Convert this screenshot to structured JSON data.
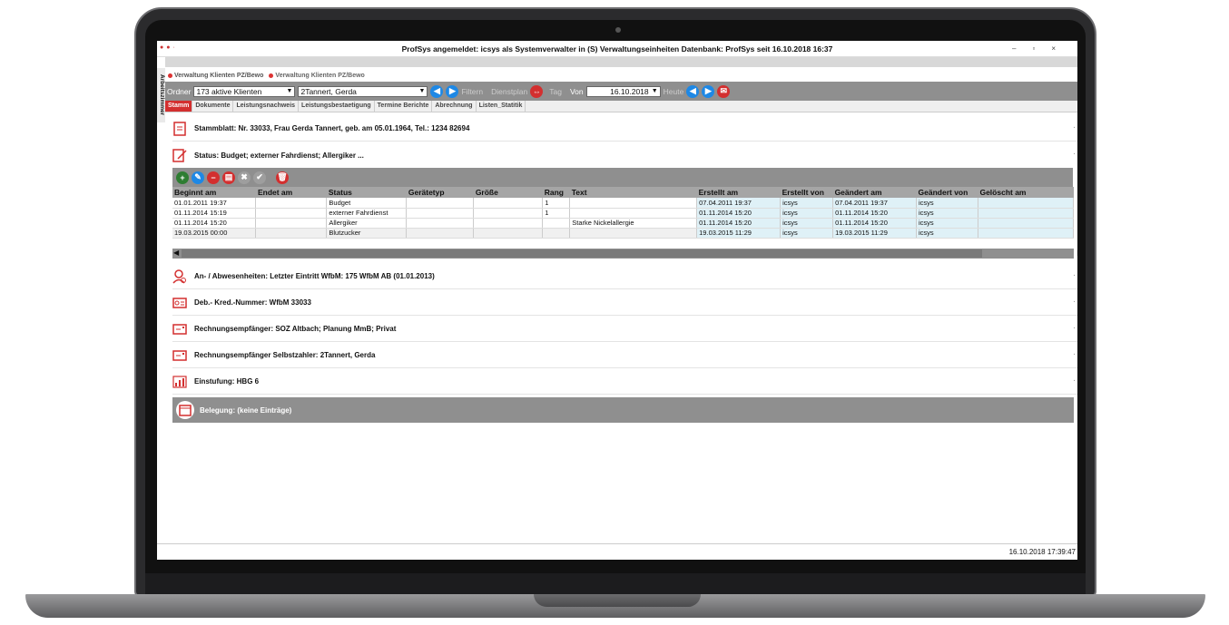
{
  "window": {
    "title": "ProfSys angemeldet: icsys als Systemverwalter in (S) Verwaltungseinheiten Datenbank: ProfSys seit 16.10.2018 16:37",
    "minimize": "–",
    "restore": "▫",
    "close": "×"
  },
  "vertical_tab": "Arbeitszimmer",
  "doc_tabs": [
    "Verwaltung Klienten PZ/Bewo",
    "Verwaltung Klienten PZ/Bewo"
  ],
  "toolbar": {
    "ordner_label": "Ordner",
    "ordner_value": "173 aktive Klienten",
    "client_value": "2Tannert, Gerda",
    "filtern": "Filtern",
    "dienstplan": "Dienstplan",
    "tag": "Tag",
    "von_label": "Von",
    "date_value": "16.10.2018",
    "heute": "Heute"
  },
  "section_tabs": [
    "Stamm",
    "Dokumente",
    "Leistungsnachweis",
    "Leistungsbestaetigung",
    "Termine Berichte",
    "Abrechnung",
    "Listen_Statitik"
  ],
  "rows": {
    "stammblatt": "Stammblatt: Nr. 33033, Frau Gerda Tannert,  geb. am 05.01.1964, Tel.: 1234 82694",
    "status": "Status: Budget; externer Fahrdienst; Allergiker ...",
    "anwesenheit": "An- / Abwesenheiten: Letzter Eintritt WfbM: 175 WfbM AB (01.01.2013)",
    "debkred": "Deb.- Kred.-Nummer: WfbM 33033",
    "rechnung": "Rechnungsempfänger: SOZ Altbach; Planung MmB; Privat",
    "selbstzahler": "Rechnungsempfänger Selbstzahler: 2Tannert, Gerda",
    "einstufung": "Einstufung: HBG 6",
    "belegung": "Belegung: (keine Einträge)"
  },
  "more_glyph": "·",
  "table": {
    "headers": [
      "Beginnt am",
      "Endet am",
      "Status",
      "Gerätetyp",
      "Größe",
      "Rang",
      "Text",
      "Erstellt am",
      "Erstellt von",
      "Geändert am",
      "Geändert von",
      "Gelöscht am"
    ],
    "rows": [
      [
        "01.01.2011 19:37",
        "",
        "Budget",
        "",
        "",
        "1",
        "",
        "07.04.2011 19:37",
        "icsys",
        "07.04.2011 19:37",
        "icsys",
        ""
      ],
      [
        "01.11.2014 15:19",
        "",
        "externer Fahrdienst",
        "",
        "",
        "1",
        "",
        "01.11.2014 15:20",
        "icsys",
        "01.11.2014 15:20",
        "icsys",
        ""
      ],
      [
        "01.11.2014 15:20",
        "",
        "Allergiker",
        "",
        "",
        "",
        "Starke Nickelallergie",
        "01.11.2014 15:20",
        "icsys",
        "01.11.2014 15:20",
        "icsys",
        ""
      ],
      [
        "19.03.2015 00:00",
        "",
        "Blutzucker",
        "",
        "",
        "",
        "",
        "19.03.2015 11:29",
        "icsys",
        "19.03.2015 11:29",
        "icsys",
        ""
      ]
    ]
  },
  "statusbar": "16.10.2018 17:39:47",
  "colors": {
    "accent_red": "#d32f2f",
    "accent_blue": "#1e88e5",
    "toolbar_gray": "#8f8f8f",
    "row_highlight": "#dff1f7"
  }
}
